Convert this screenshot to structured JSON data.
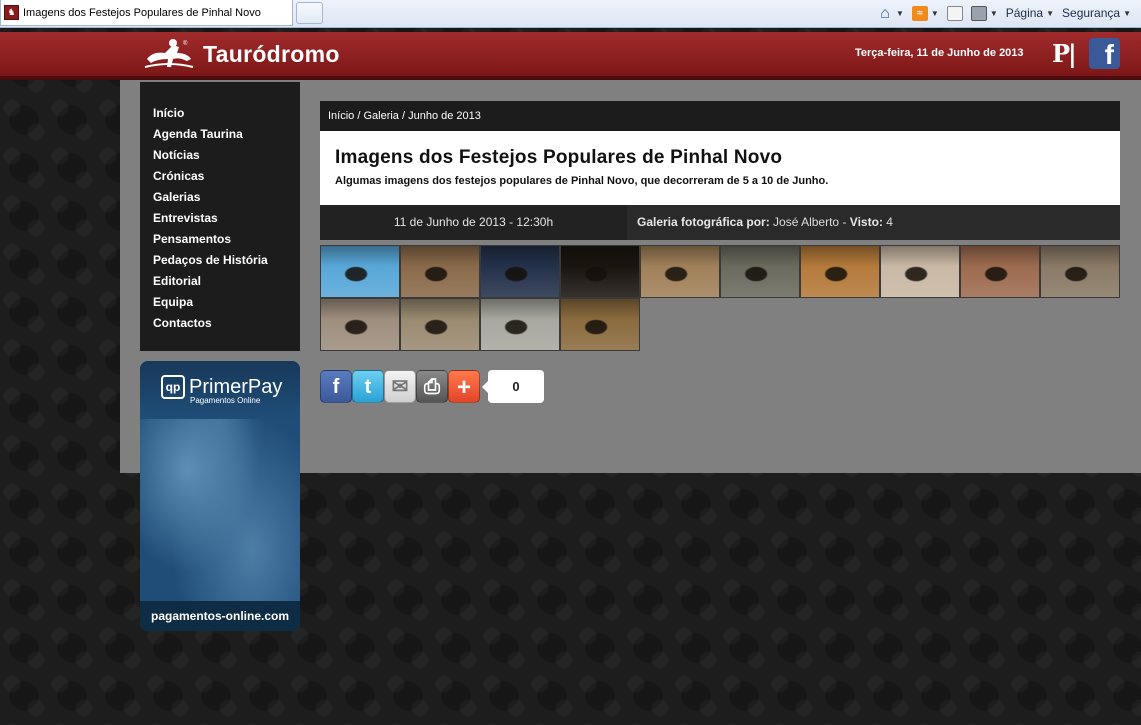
{
  "browser": {
    "tab_title": "Imagens dos Festejos Populares de Pinhal Novo",
    "commands": {
      "page": "Página",
      "security": "Segurança"
    }
  },
  "site": {
    "name": "Tauródromo",
    "date": "Terça-feira, 11 de Junho de 2013"
  },
  "nav": {
    "items": [
      "Início",
      "Agenda Taurina",
      "Notícias",
      "Crónicas",
      "Galerias",
      "Entrevistas",
      "Pensamentos",
      "Pedaços de História",
      "Editorial",
      "Equipa",
      "Contactos"
    ]
  },
  "ad": {
    "brand": "PrimerPay",
    "tagline": "Pagamentos Online",
    "url": "pagamentos-online.com"
  },
  "breadcrumb": {
    "home": "Início",
    "section": "Galeria",
    "current": "Junho de 2013",
    "sep": " / "
  },
  "article": {
    "title": "Imagens dos Festejos Populares de Pinhal Novo",
    "subtitle": "Algumas imagens dos festejos populares de Pinhal Novo, que decorreram de 5 a 10 de Junho.",
    "datetime": "11 de Junho de 2013 - 12:30h",
    "gallery_by_label": "Galeria fotográfica por:",
    "author": "José Alberto",
    "views_label": "Visto:",
    "views": "4"
  },
  "gallery": {
    "count": 14,
    "colors": [
      "#58a7d8",
      "#8a6a4a",
      "#23314a",
      "#1b1510",
      "#a08058",
      "#6b6a5e",
      "#b47a3a",
      "#c9b8a4",
      "#9d6b4f",
      "#8a7a66",
      "#9e8e7e",
      "#9a8a70",
      "#a8a8a0",
      "#8b6b3e"
    ]
  },
  "share": {
    "count": "0"
  }
}
